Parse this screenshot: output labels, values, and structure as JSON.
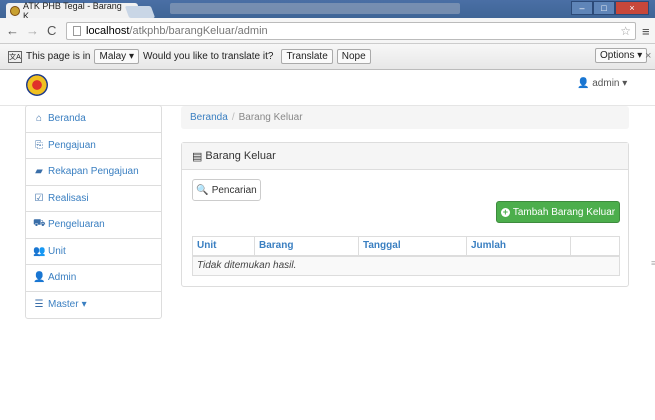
{
  "browser": {
    "tab_title": "ATK PHB Tegal - Barang K",
    "tab_close": "×",
    "window_buttons": [
      "–",
      "□",
      "×"
    ],
    "url_host": "localhost",
    "url_path": "/atkphb/barangKeluar/admin"
  },
  "translate_bar": {
    "prefix": "This page is in",
    "language": "Malay",
    "question": "Would you like to translate it?",
    "translate_label": "Translate",
    "nope_label": "Nope",
    "options_label": "Options"
  },
  "header": {
    "user_label": "admin"
  },
  "sidebar": {
    "items": [
      {
        "label": "Beranda",
        "icon": "home-icon"
      },
      {
        "label": "Pengajuan",
        "icon": "bookmark-icon"
      },
      {
        "label": "Rekapan Pengajuan",
        "icon": "book-icon"
      },
      {
        "label": "Realisasi",
        "icon": "check-icon"
      },
      {
        "label": "Pengeluaran",
        "icon": "cart-icon"
      },
      {
        "label": "Unit",
        "icon": "users-icon"
      },
      {
        "label": "Admin",
        "icon": "user-icon"
      },
      {
        "label": "Master",
        "icon": "list-icon"
      }
    ]
  },
  "breadcrumb": {
    "home": "Beranda",
    "separator": "/",
    "current": "Barang Keluar"
  },
  "panel": {
    "title": "Barang Keluar",
    "search_label": "Pencarian",
    "add_label": "Tambah Barang Keluar",
    "columns": [
      "Unit",
      "Barang",
      "Tanggal",
      "Jumlah",
      ""
    ],
    "empty_text": "Tidak ditemukan hasil."
  },
  "colors": {
    "link": "#3a7fc1",
    "success": "#4cae4c"
  }
}
